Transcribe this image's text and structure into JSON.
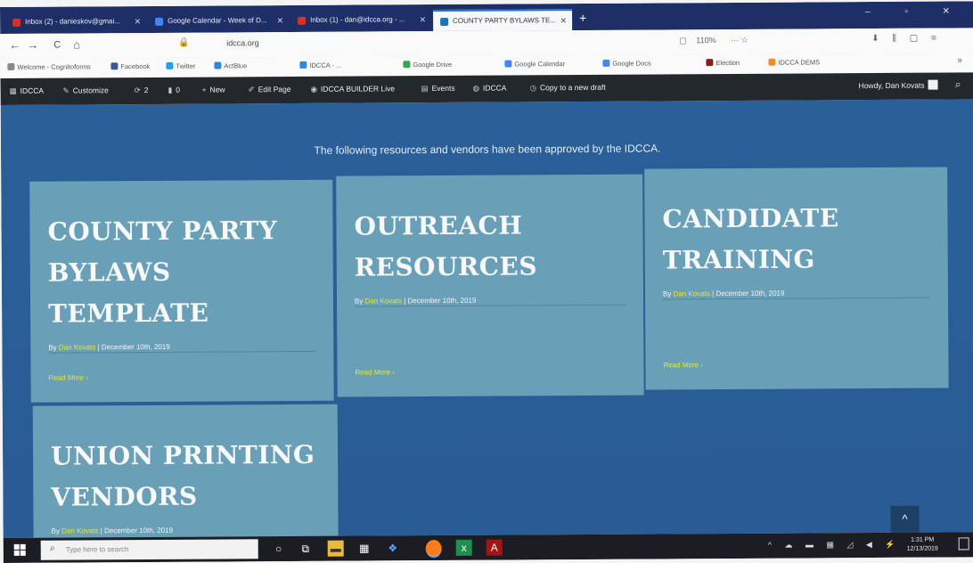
{
  "browser": {
    "tabs": [
      {
        "label": "Inbox (2) - danieskov@gmai...",
        "color": "#d93025"
      },
      {
        "label": "Google Calendar - Week of D...",
        "color": "#4285f4"
      },
      {
        "label": "Inbox (1) - dan@idcca.org - ...",
        "color": "#d93025"
      },
      {
        "label": "COUNTY PARTY BYLAWS TE...",
        "color": "#2271b1",
        "active": true
      }
    ],
    "new_tab": "+",
    "window_controls": "–  ▫  ✕",
    "nav": {
      "back": "←",
      "forward": "→",
      "reload": "C",
      "home": "⌂"
    },
    "url": "idcca.org",
    "zoom": "110%",
    "toolbar_right": "···  ☆",
    "toolbar_icons": "⬇ ⫼ ▢ ≡"
  },
  "bookmarks": [
    {
      "label": "Welcome - Cognitoforms",
      "color": "#888888"
    },
    {
      "label": "Facebook",
      "color": "#3b5998"
    },
    {
      "label": "Twitter",
      "color": "#1da1f2"
    },
    {
      "label": "ActBlue",
      "color": "#2e88d4"
    },
    {
      "label": "IDCCA - ...",
      "color": "#2e88d4"
    },
    {
      "label": "Google Drive",
      "color": "#34a853"
    },
    {
      "label": "Google Calendar",
      "color": "#4285f4"
    },
    {
      "label": "Google Docs",
      "color": "#4285f4"
    },
    {
      "label": "Election",
      "color": "#8b1c1c"
    },
    {
      "label": "IDCCA DEMS",
      "color": "#f28c28"
    }
  ],
  "admin_bar": {
    "site": "IDCCA",
    "customize": "Customize",
    "updates": "2",
    "comments": "0",
    "new": "New",
    "edit_page": "Edit Page",
    "builder": "IDCCA BUILDER Live",
    "events": "Events",
    "idcca": "IDCCA",
    "copy_draft": "Copy to a new draft",
    "howdy": "Howdy, Dan Kovats"
  },
  "page": {
    "intro": "The following resources and vendors have been approved by the IDCCA.",
    "by": "By",
    "sep": "|",
    "cards": [
      {
        "title": "COUNTY PARTY BYLAWS TEMPLATE",
        "author": "Dan Kovats",
        "date": "December 10th, 2019",
        "more": "Read More ›"
      },
      {
        "title": "OUTREACH RESOURCES",
        "author": "Dan Kovats",
        "date": "December 10th, 2019",
        "more": "Read More ›"
      },
      {
        "title": "CANDIDATE TRAINING",
        "author": "Dan Kovats",
        "date": "December 10th, 2019",
        "more": "Read More ›"
      },
      {
        "title": "UNION PRINTING VENDORS",
        "author": "Dan Kovats",
        "date": "December 10th, 2019"
      }
    ],
    "back_to_top": "^"
  },
  "taskbar": {
    "search_placeholder": "Type here to search",
    "time": "1:31 PM",
    "date": "12/13/2019"
  }
}
